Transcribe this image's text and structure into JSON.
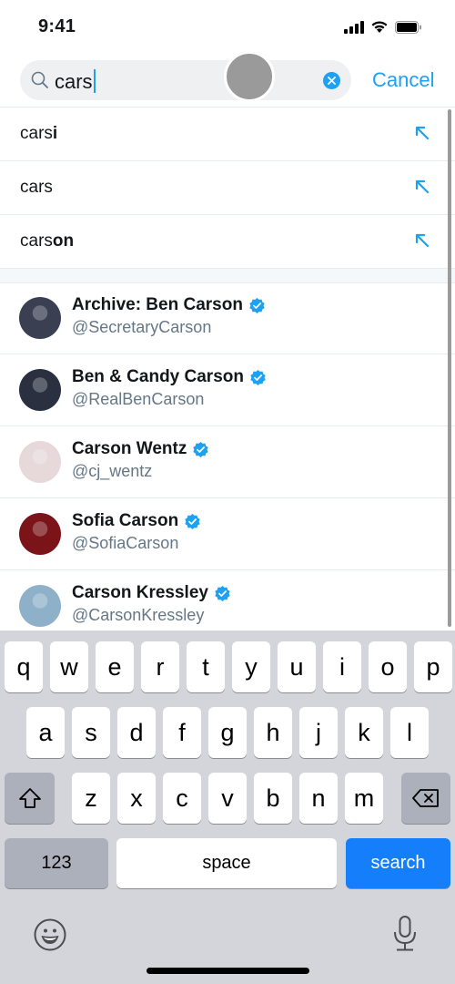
{
  "status_bar": {
    "time": "9:41",
    "icons": [
      "signal-icon",
      "wifi-icon",
      "battery-icon"
    ]
  },
  "search": {
    "value": "cars",
    "clear_icon": "clear-icon",
    "cancel_label": "Cancel",
    "accent": "#1da1f2"
  },
  "suggestions": [
    {
      "prefix": "cars",
      "suffix": "i",
      "full": "carsi"
    },
    {
      "prefix": "cars",
      "suffix": "",
      "full": "cars"
    },
    {
      "prefix": "cars",
      "suffix": "on",
      "full": "carson"
    }
  ],
  "users": [
    {
      "name": "Archive: Ben Carson",
      "handle": "@SecretaryCarson",
      "verified": true,
      "avatar_color": "#3b3f52"
    },
    {
      "name": "Ben & Candy Carson",
      "handle": "@RealBenCarson",
      "verified": true,
      "avatar_color": "#2b3040"
    },
    {
      "name": "Carson Wentz",
      "handle": "@cj_wentz",
      "verified": true,
      "avatar_color": "#e7d8da"
    },
    {
      "name": "Sofia Carson",
      "handle": "@SofiaCarson",
      "verified": true,
      "avatar_color": "#7a1418"
    },
    {
      "name": "Carson Kressley",
      "handle": "@CarsonKressley",
      "verified": true,
      "avatar_color": "#8fb0c9"
    }
  ],
  "keyboard": {
    "row1": [
      "q",
      "w",
      "e",
      "r",
      "t",
      "y",
      "u",
      "i",
      "o",
      "p"
    ],
    "row2": [
      "a",
      "s",
      "d",
      "f",
      "g",
      "h",
      "j",
      "k",
      "l"
    ],
    "row3": [
      "z",
      "x",
      "c",
      "v",
      "b",
      "n",
      "m"
    ],
    "numbers_label": "123",
    "space_label": "space",
    "return_label": "search",
    "return_color": "#147efb"
  }
}
